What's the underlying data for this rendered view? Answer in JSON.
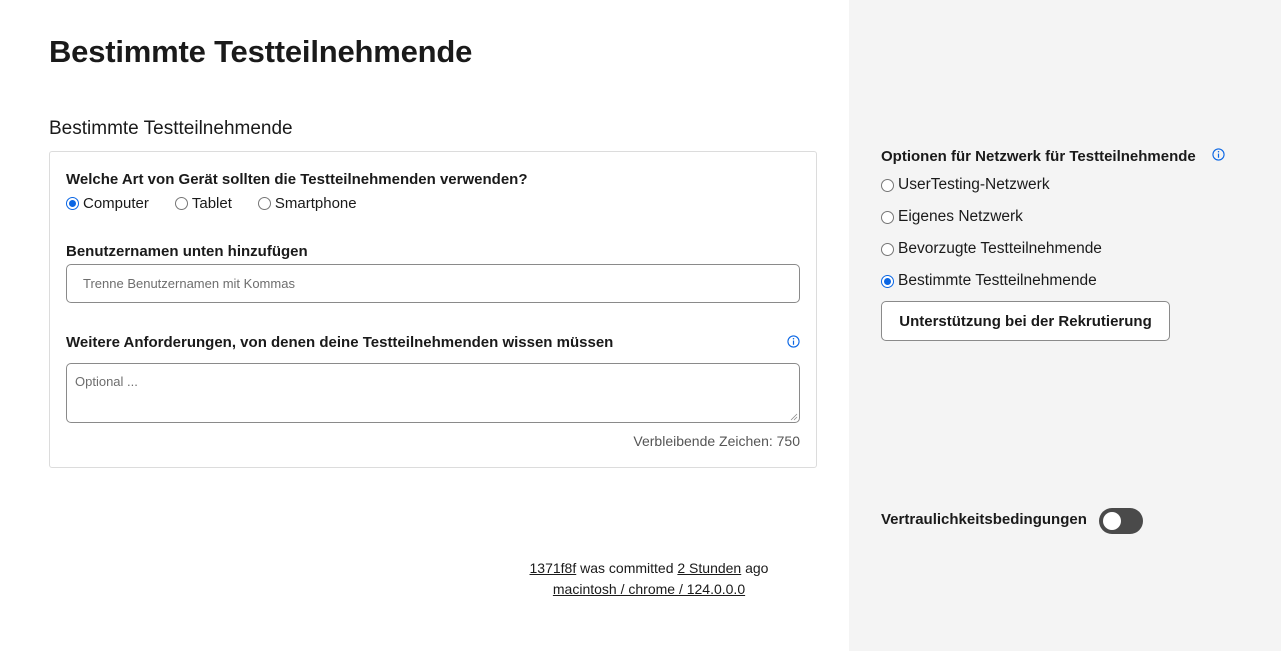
{
  "page": {
    "title": "Bestimmte Testteilnehmende",
    "section_title": "Bestimmte Testteilnehmende"
  },
  "form": {
    "device_question": "Welche Art von Gerät sollten die Testteilnehmenden verwenden?",
    "device_options": [
      {
        "label": "Computer",
        "selected": true
      },
      {
        "label": "Tablet",
        "selected": false
      },
      {
        "label": "Smartphone",
        "selected": false
      }
    ],
    "usernames_label": "Benutzernamen unten hinzufügen",
    "usernames_placeholder": "Trenne Benutzernamen mit Kommas",
    "usernames_value": "",
    "requirements_label": "Weitere Anforderungen, von denen deine Testteilnehmenden wissen müssen",
    "requirements_placeholder": "Optional ...",
    "requirements_value": "",
    "remaining_chars": "Verbleibende Zeichen: 750",
    "info_icon": "info-icon"
  },
  "footer": {
    "commit_hash": "1371f8f",
    "committed_text": "was committed",
    "time_link": "2 Stunden",
    "ago_text": "ago",
    "env_link": "macintosh / chrome / 124.0.0.0"
  },
  "sidebar": {
    "network_heading": "Optionen für Netzwerk für Testteilnehmende",
    "network_options": [
      {
        "label": "UserTesting-Netzwerk",
        "selected": false
      },
      {
        "label": "Eigenes Netzwerk",
        "selected": false
      },
      {
        "label": "Bevorzugte Testteilnehmende",
        "selected": false
      },
      {
        "label": "Bestimmte Testteilnehmende",
        "selected": true
      }
    ],
    "recruit_button": "Unterstützung bei der Rekrutierung",
    "confidentiality_label": "Vertraulichkeitsbedingungen",
    "confidentiality_enabled": false
  },
  "colors": {
    "accent": "#0a66e4",
    "sidebar_bg": "#f4f4f4",
    "toggle_off": "#4a4a4a"
  }
}
